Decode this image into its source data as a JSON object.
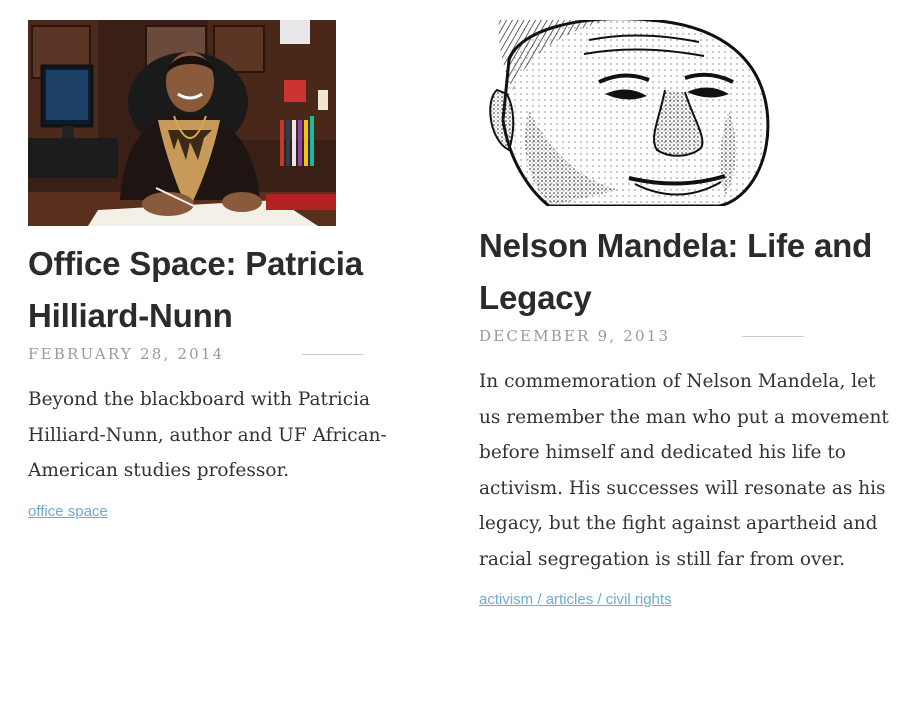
{
  "posts": [
    {
      "title": "Office Space: Patricia Hilliard-Nunn",
      "date": "FEBRUARY 28, 2014",
      "excerpt": "Beyond the blackboard with Patricia Hilliard-Nunn, author and UF African-American studies professor.",
      "tags": [
        "office space"
      ],
      "image_icon": "portrait-photo"
    },
    {
      "title": "Nelson Mandela: Life and Legacy",
      "date": "DECEMBER 9, 2013",
      "excerpt": "In commemoration of Nelson Mandela, let us remember the man who put a movement before himself and dedicated his life to activism. His successes will resonate as his legacy, but the fight against apartheid and racial segregation is still far from over.",
      "tags": [
        "activism",
        "articles",
        "civil rights"
      ],
      "tag_separator": " / ",
      "image_icon": "ink-sketch-portrait"
    }
  ],
  "colors": {
    "title": "#2b2b2b",
    "date": "#9a9a9a",
    "body": "#333333",
    "link": "#6aaed3"
  }
}
